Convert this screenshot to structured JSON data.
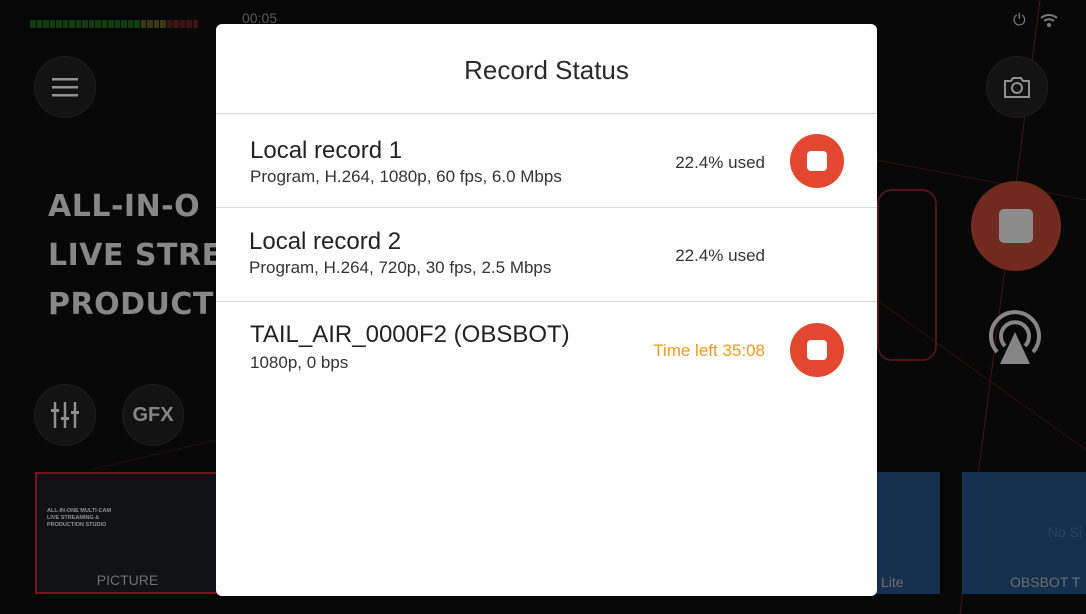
{
  "background": {
    "timecode": "00:05",
    "hero_lines": [
      "ALL-IN-O",
      "LIVE STRE",
      "PRODUCT"
    ],
    "gfx_label": "GFX",
    "thumbnails": [
      {
        "label": "PICTURE",
        "mini_text": "ALL-IN-ONE MULTI-CAM\nLIVE STREAMING &\nPRODUCTION STUDIO"
      },
      {
        "label": "Lite"
      },
      {
        "label": "OBSBOT T",
        "no_signal": "No Si"
      }
    ]
  },
  "dialog": {
    "title": "Record Status",
    "records": [
      {
        "name": "Local record 1",
        "detail": "Program, H.264, 1080p, 60 fps, 6.0 Mbps",
        "status": "22.4% used",
        "status_type": "normal",
        "has_stop": true
      },
      {
        "name": "Local record 2",
        "detail": "Program, H.264, 720p, 30 fps, 2.5 Mbps",
        "status": "22.4% used",
        "status_type": "normal",
        "has_stop": false
      },
      {
        "name": "TAIL_AIR_0000F2 (OBSBOT)",
        "detail": "1080p, 0 bps",
        "status": "Time left 35:08",
        "status_type": "warning",
        "has_stop": true
      }
    ]
  },
  "colors": {
    "stop_button": "#e3472f",
    "warning_text": "#f39a1b",
    "dialog_bg": "#ffffff"
  }
}
